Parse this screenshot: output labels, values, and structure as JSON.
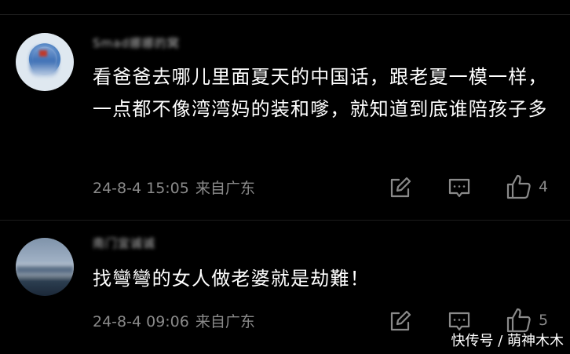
{
  "comments": [
    {
      "username": "Smad娜娜的窝",
      "text": "看爸爸去哪儿里面夏天的中国话，跟老夏一模一样，一点都不像湾湾妈的装和嗲，就知道到底谁陪孩子多",
      "date": "24-8-4 15:05",
      "region": "来自广东",
      "like_count": "4"
    },
    {
      "username": "南门宜诚诚",
      "text": "找彎彎的女人做老婆就是劫難！",
      "date": "24-8-4 09:06",
      "region": "来自广东",
      "like_count": "5"
    }
  ],
  "icons": {
    "edit": "edit-icon",
    "reply": "comment-icon",
    "like": "thumbs-up-icon"
  },
  "watermark": "快传号 / 萌神木木",
  "colors": {
    "background": "#000000",
    "text": "#ffffff",
    "muted": "#8a8a8a"
  }
}
